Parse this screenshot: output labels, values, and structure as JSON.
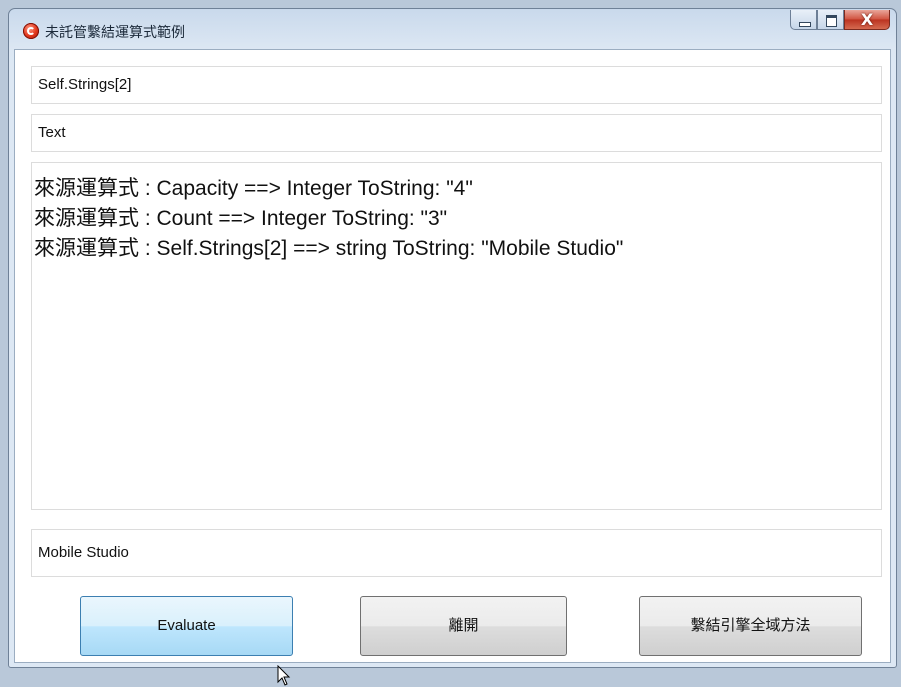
{
  "window": {
    "title": "未託管繫結運算式範例",
    "close_glyph": "X"
  },
  "fields": {
    "source_expression": "Self.Strings[2]",
    "target_property": "Text",
    "result": "Mobile Studio"
  },
  "log": {
    "lines": [
      "來源運算式 : Capacity  ==> Integer ToString: \"4\"",
      "來源運算式 : Count  ==> Integer ToString: \"3\"",
      "來源運算式 : Self.Strings[2]  ==> string ToString: \"Mobile Studio\""
    ]
  },
  "buttons": {
    "evaluate": "Evaluate",
    "exit": "離開",
    "bind_global_methods": "繫結引擎全域方法"
  },
  "colors": {
    "hover_button": "#bee6fd",
    "close_button": "#c7432f"
  }
}
